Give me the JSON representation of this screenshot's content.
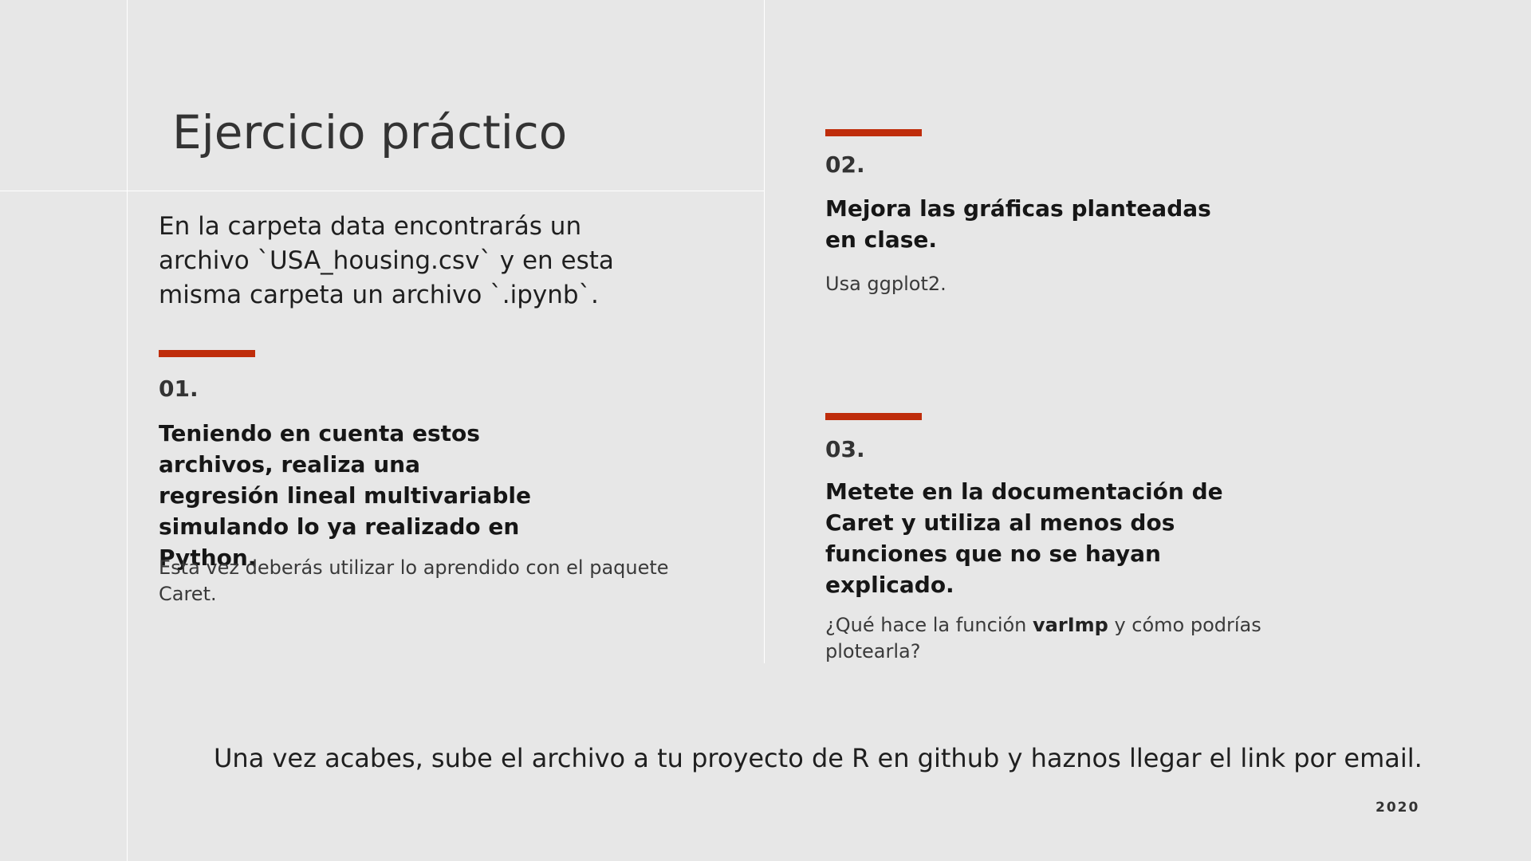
{
  "slide": {
    "title": "Ejercicio práctico",
    "intro": "En la carpeta data encontrarás un archivo `USA_housing.csv` y en esta misma carpeta un archivo `.ipynb`.",
    "accent_color": "#bf2d0b",
    "items": [
      {
        "number": "01.",
        "heading": "Teniendo en cuenta estos archivos, realiza una regresión lineal multivariable simulando lo ya realizado en Python.",
        "body": "Esta vez deberás utilizar lo aprendido con el paquete Caret."
      },
      {
        "number": "02.",
        "heading": "Mejora las gráficas planteadas en clase.",
        "body": "Usa ggplot2."
      },
      {
        "number": "03.",
        "heading": "Metete en la documentación de Caret y utiliza al menos dos funciones que no se hayan explicado.",
        "body_prefix": "¿Qué hace la función ",
        "body_bold": "varImp",
        "body_suffix": " y cómo podrías plotearla?"
      }
    ],
    "footer": "Una vez acabes, sube el archivo a tu proyecto de R en github y haznos llegar el link por email.",
    "year": "2020"
  }
}
